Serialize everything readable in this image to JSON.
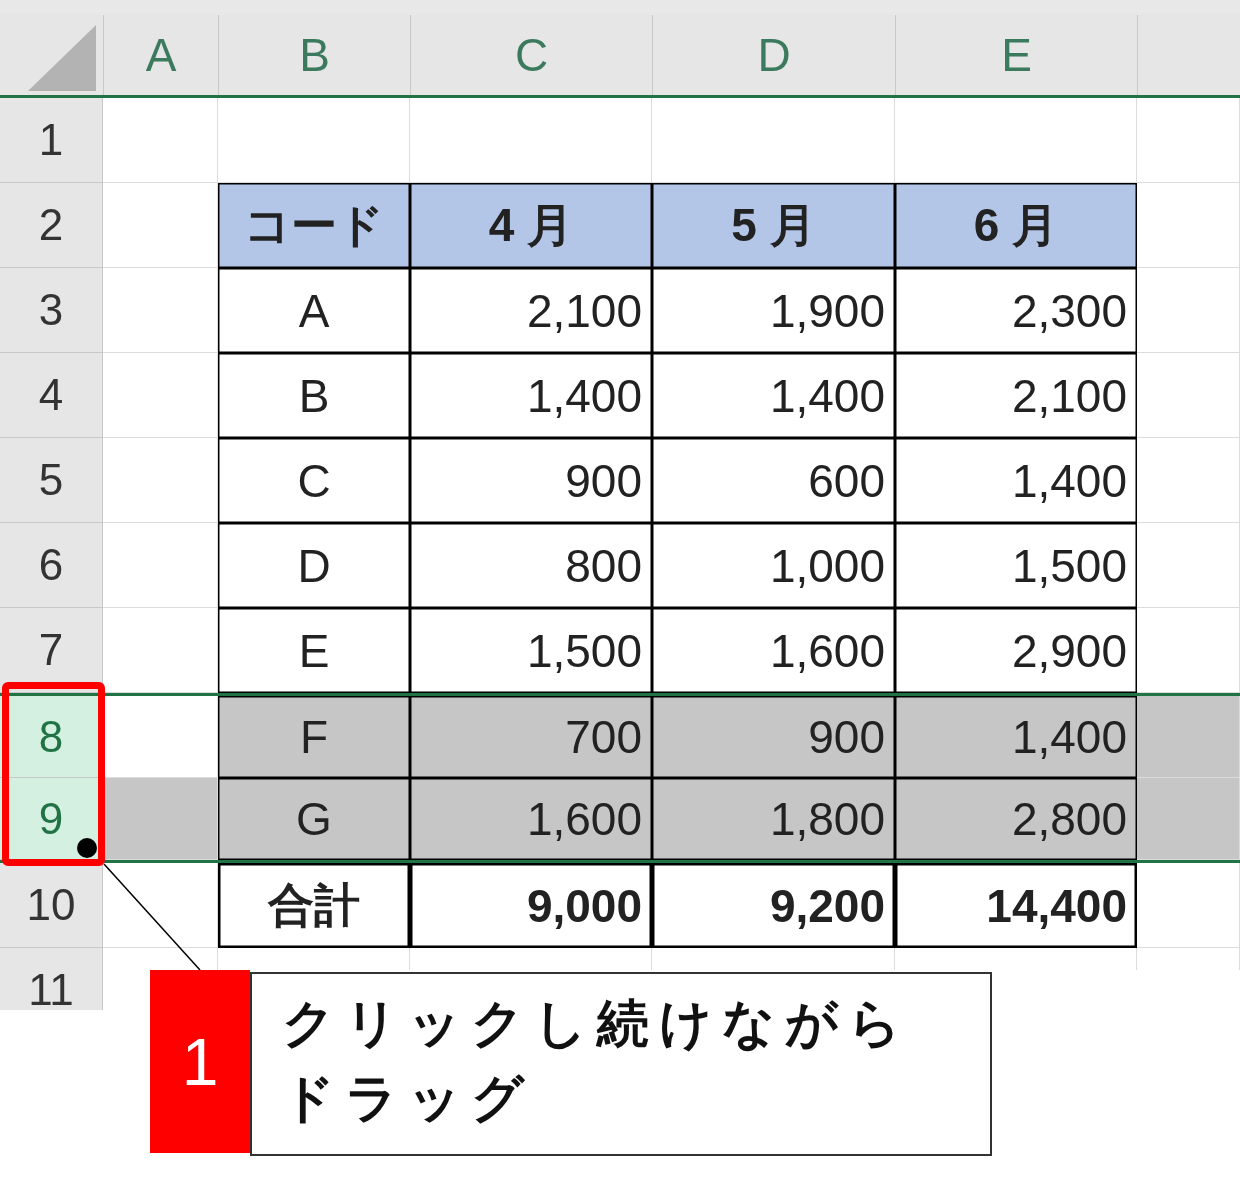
{
  "sheet": {
    "columns": [
      "A",
      "B",
      "C",
      "D",
      "E"
    ],
    "rows": [
      {
        "number": "1",
        "selected": false,
        "kind": "empty"
      },
      {
        "number": "2",
        "selected": false,
        "kind": "heading",
        "cells": [
          "コード",
          "4 月",
          "5 月",
          "6 月"
        ]
      },
      {
        "number": "3",
        "selected": false,
        "kind": "data",
        "cells": [
          "A",
          "2,100",
          "1,900",
          "2,300"
        ]
      },
      {
        "number": "4",
        "selected": false,
        "kind": "data",
        "cells": [
          "B",
          "1,400",
          "1,400",
          "2,100"
        ]
      },
      {
        "number": "5",
        "selected": false,
        "kind": "data",
        "cells": [
          "C",
          "900",
          "600",
          "1,400"
        ]
      },
      {
        "number": "6",
        "selected": false,
        "kind": "data",
        "cells": [
          "D",
          "800",
          "1,000",
          "1,500"
        ]
      },
      {
        "number": "7",
        "selected": false,
        "kind": "data",
        "cells": [
          "E",
          "1,500",
          "1,600",
          "2,900"
        ]
      },
      {
        "number": "8",
        "selected": true,
        "kind": "data",
        "cells": [
          "F",
          "700",
          "900",
          "1,400"
        ]
      },
      {
        "number": "9",
        "selected": true,
        "kind": "data",
        "cells": [
          "G",
          "1,600",
          "1,800",
          "2,800"
        ]
      },
      {
        "number": "10",
        "selected": false,
        "kind": "total",
        "cells": [
          "合計",
          "9,000",
          "9,200",
          "14,400"
        ]
      },
      {
        "number": "11",
        "selected": false,
        "kind": "empty"
      }
    ]
  },
  "callout": {
    "number": "1",
    "text": "クリックし続けながらドラッグ"
  }
}
